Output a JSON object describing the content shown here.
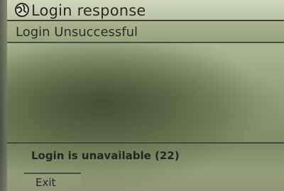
{
  "dialog": {
    "title": "Login response",
    "icon": "globe-icon",
    "message": "Login Unsuccessful",
    "status": "Login is unavailable (22)",
    "exit_label": "Exit"
  },
  "colors": {
    "screen": "#aab48e",
    "title_bar": "#c8cfb2",
    "text": "#2a2c24"
  }
}
